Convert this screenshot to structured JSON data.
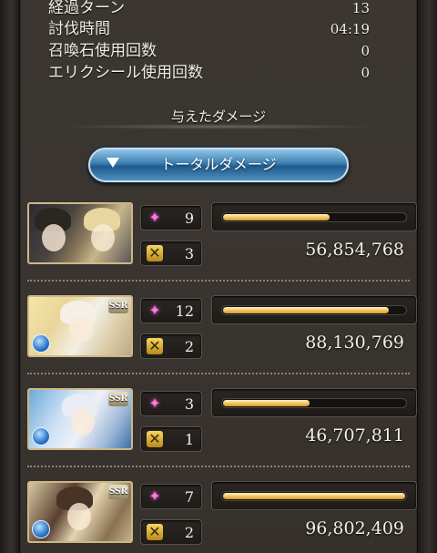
{
  "stats": [
    {
      "label": "経過ターン",
      "value": "13"
    },
    {
      "label": "討伐時間",
      "value": "04:19"
    },
    {
      "label": "召喚石使用回数",
      "value": "0"
    },
    {
      "label": "エリクシール使用回数",
      "value": "0"
    }
  ],
  "section_title": "与えたダメージ",
  "total_button": {
    "label": "トータルダメージ",
    "icon": "triangle-down-icon"
  },
  "characters": [
    {
      "portrait": "main-character",
      "skill_count": "9",
      "ca_count": "3",
      "damage": "56,854,768",
      "damage_ratio": 0.59,
      "rarity": ""
    },
    {
      "portrait": "character-1",
      "skill_count": "12",
      "ca_count": "2",
      "damage": "88,130,769",
      "damage_ratio": 0.91,
      "rarity": "SSR"
    },
    {
      "portrait": "character-2",
      "skill_count": "3",
      "ca_count": "1",
      "damage": "46,707,811",
      "damage_ratio": 0.48,
      "rarity": "SSR"
    },
    {
      "portrait": "character-3",
      "skill_count": "7",
      "ca_count": "2",
      "damage": "96,802,409",
      "damage_ratio": 1.0,
      "rarity": "SSR"
    }
  ],
  "colors": {
    "bar": "#f5c866",
    "button": "#3d7fb0",
    "panel": "#3a3530"
  }
}
